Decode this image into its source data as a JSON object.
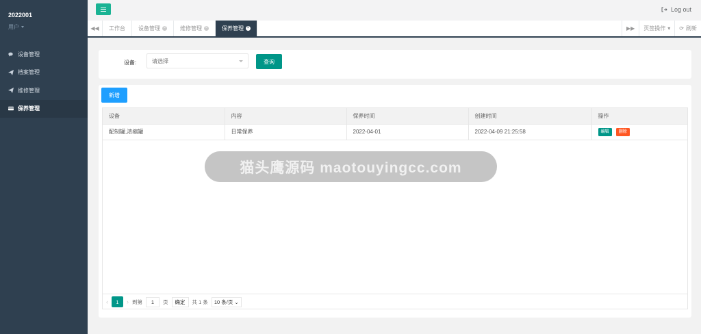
{
  "sidebar": {
    "user_name": "2022001",
    "user_role": "用户",
    "items": [
      {
        "label": "设备管理",
        "icon": "comments-icon"
      },
      {
        "label": "档案管理",
        "icon": "send-icon"
      },
      {
        "label": "维修管理",
        "icon": "send-icon"
      },
      {
        "label": "保养管理",
        "icon": "card-icon"
      }
    ],
    "active_index": 3
  },
  "topbar": {
    "logout_label": "Log out"
  },
  "tabs": {
    "items": [
      {
        "label": "工作台",
        "closable": false
      },
      {
        "label": "设备管理",
        "closable": true
      },
      {
        "label": "维修管理",
        "closable": true
      },
      {
        "label": "保养管理",
        "closable": true
      }
    ],
    "active_index": 3,
    "page_ops_label": "页签操作",
    "refresh_label": "刷新"
  },
  "search": {
    "label": "设备:",
    "placeholder": "请选择",
    "query_label": "查询"
  },
  "table": {
    "add_label": "新增",
    "columns": [
      "设备",
      "内容",
      "保养时间",
      "创建时间",
      "操作"
    ],
    "rows": [
      {
        "device": "配制罐,浓缩罐",
        "content": "日常保养",
        "maint_time": "2022-04-01",
        "created": "2022-04-09 21:25:58"
      }
    ],
    "edit_label": "编辑",
    "delete_label": "删除"
  },
  "pager": {
    "current_page": "1",
    "goto_prefix": "到第",
    "goto_value": "1",
    "goto_suffix": "页",
    "confirm_label": "确定",
    "total_label": "共 1 条",
    "page_size_label": "10 条/页"
  },
  "watermark": {
    "banner_text": "猫头鹰源码 maotouyingcc.com"
  }
}
